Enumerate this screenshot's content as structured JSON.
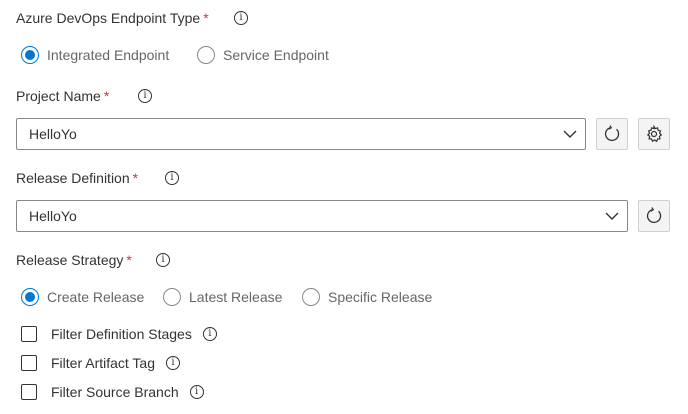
{
  "endpoint_type": {
    "label": "Azure DevOps Endpoint Type",
    "required_mark": "*",
    "options": [
      {
        "label": "Integrated Endpoint",
        "checked": true
      },
      {
        "label": "Service Endpoint",
        "checked": false
      }
    ]
  },
  "project_name": {
    "label": "Project Name",
    "required_mark": "*",
    "value": "HelloYo"
  },
  "release_definition": {
    "label": "Release Definition",
    "required_mark": "*",
    "value": "HelloYo"
  },
  "release_strategy": {
    "label": "Release Strategy",
    "required_mark": "*",
    "options": [
      {
        "label": "Create Release",
        "checked": true
      },
      {
        "label": "Latest Release",
        "checked": false
      },
      {
        "label": "Specific Release",
        "checked": false
      }
    ]
  },
  "filters": [
    {
      "label": "Filter Definition Stages",
      "checked": false
    },
    {
      "label": "Filter Artifact Tag",
      "checked": false
    },
    {
      "label": "Filter Source Branch",
      "checked": false
    }
  ],
  "icons": {
    "info": "info-icon",
    "refresh": "refresh-icon",
    "settings": "gear-icon",
    "dropdown": "chevron-down-icon"
  },
  "colors": {
    "accent": "#0078d4",
    "required": "#d13438",
    "text": "#333333",
    "muted_text": "#666666",
    "border": "#8a8886"
  }
}
